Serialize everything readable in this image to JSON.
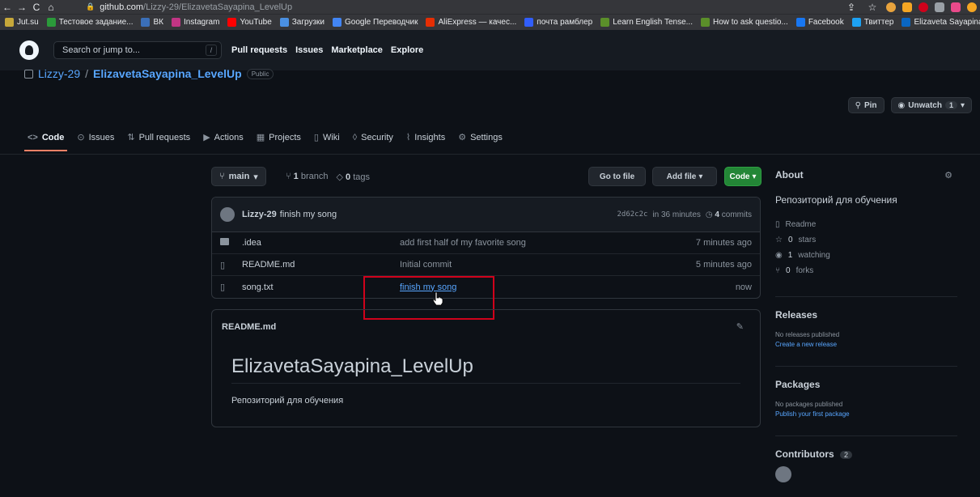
{
  "browser": {
    "url_host": "github.com",
    "url_path": "/Lizzy-29/ElizavetaSayapina_LevelUp",
    "bookmarks": [
      {
        "label": "Jut.su",
        "icon": "jutsu-icon",
        "color": "#c7a83a"
      },
      {
        "label": "Тестовое задание...",
        "icon": "plus-icon",
        "color": "#2b9a3a"
      },
      {
        "label": "ВК",
        "icon": "vk-icon",
        "color": "#3b6fb8"
      },
      {
        "label": "Instagram",
        "icon": "instagram-icon",
        "color": "#c13584"
      },
      {
        "label": "YouTube",
        "icon": "youtube-icon",
        "color": "#ff0000"
      },
      {
        "label": "Загрузки",
        "icon": "download-icon",
        "color": "#4a90e2"
      },
      {
        "label": "Google Переводчик",
        "icon": "translate-icon",
        "color": "#4285f4"
      },
      {
        "label": "AliExpress — качес...",
        "icon": "aliexpress-icon",
        "color": "#e62e04"
      },
      {
        "label": "почта рамблер",
        "icon": "mail-icon",
        "color": "#315efb"
      },
      {
        "label": "Learn English Tense...",
        "icon": "ev-icon",
        "color": "#5b8f2a"
      },
      {
        "label": "How to ask questio...",
        "icon": "ev-icon",
        "color": "#5b8f2a"
      },
      {
        "label": "Facebook",
        "icon": "facebook-icon",
        "color": "#1877f2"
      },
      {
        "label": "Твиттер",
        "icon": "twitter-icon",
        "color": "#1da1f2"
      },
      {
        "label": "Elizaveta Sayapina |...",
        "icon": "linkedin-icon",
        "color": "#0a66c2"
      }
    ]
  },
  "header": {
    "search_placeholder": "Search or jump to...",
    "slash": "/",
    "nav": [
      "Pull requests",
      "Issues",
      "Marketplace",
      "Explore"
    ]
  },
  "repo": {
    "owner": "Lizzy-29",
    "sep": "/",
    "name": "ElizavetaSayapina_LevelUp",
    "visibility": "Public",
    "pin_label": "Pin",
    "unwatch_label": "Unwatch",
    "watch_count": "1"
  },
  "tabs": [
    {
      "label": "Code",
      "icon": "<>"
    },
    {
      "label": "Issues",
      "icon": "⊙"
    },
    {
      "label": "Pull requests",
      "icon": "⇅"
    },
    {
      "label": "Actions",
      "icon": "▶"
    },
    {
      "label": "Projects",
      "icon": "▦"
    },
    {
      "label": "Wiki",
      "icon": "▯"
    },
    {
      "label": "Security",
      "icon": "◊"
    },
    {
      "label": "Insights",
      "icon": "⌇"
    },
    {
      "label": "Settings",
      "icon": "⚙"
    }
  ],
  "toolbar": {
    "branch": "main",
    "branch_count": "1",
    "branch_word": "branch",
    "tag_count": "0",
    "tag_word": "tags",
    "go_to_file": "Go to file",
    "add_file": "Add file",
    "code": "Code"
  },
  "commit": {
    "author": "Lizzy-29",
    "message": "finish my song",
    "sha": "2d62c2c",
    "time": "in 36 minutes",
    "count": "4",
    "count_word": "commits"
  },
  "files": [
    {
      "name": ".idea",
      "type": "folder",
      "message": "add first half of my favorite song",
      "time": "7 minutes ago",
      "link": false
    },
    {
      "name": "README.md",
      "type": "file",
      "message": "Initial commit",
      "time": "5 minutes ago",
      "link": false
    },
    {
      "name": "song.txt",
      "type": "file",
      "message": "finish my song",
      "time": "now",
      "link": true
    }
  ],
  "readme": {
    "filename": "README.md",
    "title": "ElizavetaSayapina_LevelUp",
    "text": "Репозиторий для обучения"
  },
  "about": {
    "heading": "About",
    "description": "Репозиторий для обучения",
    "readme_label": "Readme",
    "stars": "0",
    "stars_word": "stars",
    "watching": "1",
    "watching_word": "watching",
    "forks": "0",
    "forks_word": "forks"
  },
  "releases": {
    "heading": "Releases",
    "empty": "No releases published",
    "link": "Create a new release"
  },
  "packages": {
    "heading": "Packages",
    "empty": "No packages published",
    "link": "Publish your first package"
  },
  "contributors": {
    "heading": "Contributors",
    "count": "2"
  },
  "colors": {
    "accent": "#58a6ff",
    "highlight": "#d0021b",
    "code_button": "#238636",
    "tab_underline": "#f78166"
  }
}
